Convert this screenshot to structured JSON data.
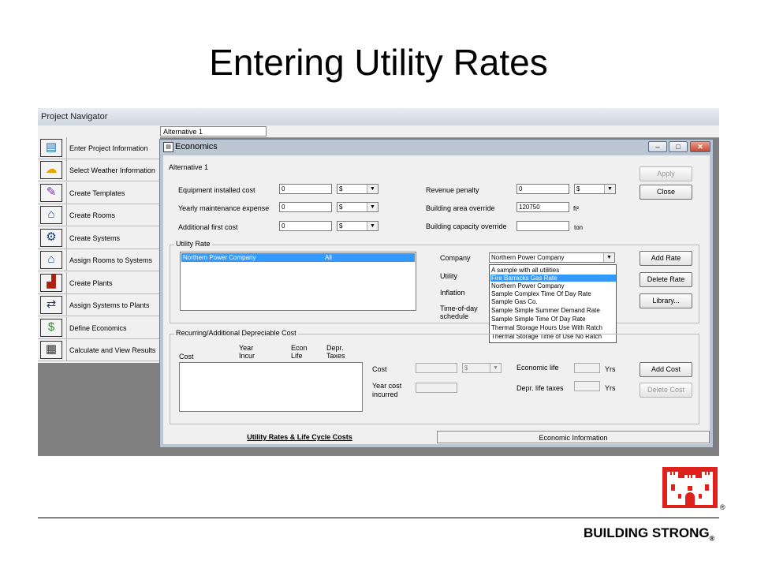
{
  "slide": {
    "title": "Entering Utility Rates",
    "footer_text": "BUILDING STRONG",
    "footer_mark": "®",
    "logo_mark": "®",
    "logo_color": "#e0211b"
  },
  "navigator": {
    "title": "Project Navigator",
    "alt_tab": "Alternative 1",
    "items": [
      {
        "label": "Enter Project Information",
        "icon": "project-info-icon"
      },
      {
        "label": "Select Weather Information",
        "icon": "weather-icon"
      },
      {
        "label": "Create Templates",
        "icon": "templates-icon"
      },
      {
        "label": "Create Rooms",
        "icon": "rooms-icon"
      },
      {
        "label": "Create Systems",
        "icon": "systems-icon"
      },
      {
        "label": "Assign Rooms to Systems",
        "icon": "assign-rooms-icon"
      },
      {
        "label": "Create Plants",
        "icon": "plants-icon"
      },
      {
        "label": "Assign Systems to Plants",
        "icon": "assign-systems-icon"
      },
      {
        "label": "Define Economics",
        "icon": "economics-icon"
      },
      {
        "label": "Calculate and View Results",
        "icon": "calculator-icon"
      }
    ]
  },
  "economics": {
    "title": "Economics",
    "alternative": "Alternative 1",
    "apply": "Apply",
    "close": "Close",
    "minimize": "‒",
    "maximize": "□",
    "close_x": "✕",
    "equipment_cost_label": "Equipment installed cost",
    "equipment_cost": "0",
    "equipment_unit": "$",
    "maintenance_label": "Yearly maintenance expense",
    "maintenance": "0",
    "maintenance_unit": "$",
    "first_cost_label": "Additional first cost",
    "first_cost": "0",
    "first_cost_unit": "$",
    "revenue_penalty_label": "Revenue penalty",
    "revenue_penalty": "0",
    "revenue_unit": "$",
    "area_override_label": "Building area override",
    "area_override": "120750",
    "area_unit": "ft²",
    "capacity_override_label": "Building capacity override",
    "capacity_override": "",
    "capacity_unit": "ton",
    "utility_rate_group": "Utility Rate",
    "rate_list": [
      {
        "name": "Northern Power Company",
        "scope": "All"
      }
    ],
    "company_label": "Company",
    "company_value": "Northern Power Company",
    "utility_label": "Utility",
    "inflation_label": "Inflation",
    "tod_label_1": "Time-of-day",
    "tod_label_2": "schedule",
    "company_options": [
      "A sample with all utilities",
      "Fire Barracks Gas Rate",
      "Northern Power Company",
      "Sample Complex Time Of Day Rate",
      "Sample Gas Co.",
      "Sample Simple Summer Demand Rate",
      "Sample Simple Time Of Day Rate",
      "Thermal Storage Hours Use With Ratch",
      "Thermal Storage Time of Use No Ratch"
    ],
    "highlighted_option": "Fire Barracks Gas Rate",
    "add_rate": "Add Rate",
    "delete_rate": "Delete Rate",
    "library": "Library...",
    "recurring_group": "Recurring/Additional Depreciable Cost",
    "cols": {
      "cost": "Cost",
      "year_1": "Year",
      "year_2": "Incur",
      "econ_1": "Econ",
      "econ_2": "Life",
      "depr_1": "Depr.",
      "depr_2": "Taxes"
    },
    "cost_label": "Cost",
    "cost_unit": "$",
    "year_cost_1": "Year cost",
    "year_cost_2": "incurred",
    "economic_life_label": "Economic life",
    "economic_life_unit": "Yrs",
    "depr_life_label": "Depr. life taxes",
    "depr_life_unit": "Yrs",
    "add_cost": "Add Cost",
    "delete_cost": "Delete Cost",
    "tab_utility": "Utility Rates & Life Cycle Costs",
    "tab_economic": "Economic Information"
  }
}
